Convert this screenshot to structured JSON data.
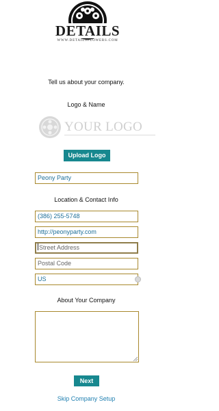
{
  "brand": {
    "name": "DETAILS",
    "url": "WWW.DETAILSFLOWERS.COM"
  },
  "intro": {
    "text": "Tell us about your company."
  },
  "logo_section": {
    "heading": "Logo & Name",
    "placeholder_text": "YOUR LOGO",
    "upload_button": "Upload Logo"
  },
  "company_name": {
    "value": "Peony Party"
  },
  "contact_section": {
    "heading": "Location & Contact Info",
    "phone": {
      "value": "(386) 255-5748"
    },
    "website": {
      "value": "http://peonyparty.com"
    },
    "street": {
      "placeholder": "Street Address"
    },
    "postal": {
      "placeholder": "Postal Code"
    },
    "country": {
      "value": "US"
    }
  },
  "about_section": {
    "heading": "About Your Company",
    "value": ""
  },
  "actions": {
    "next_button": "Next",
    "skip_link": "Skip Company Setup"
  },
  "colors": {
    "accent": "#17888f",
    "field_border": "#a8882c",
    "link": "#1f7fb0",
    "filled_text": "#1e6f99"
  }
}
